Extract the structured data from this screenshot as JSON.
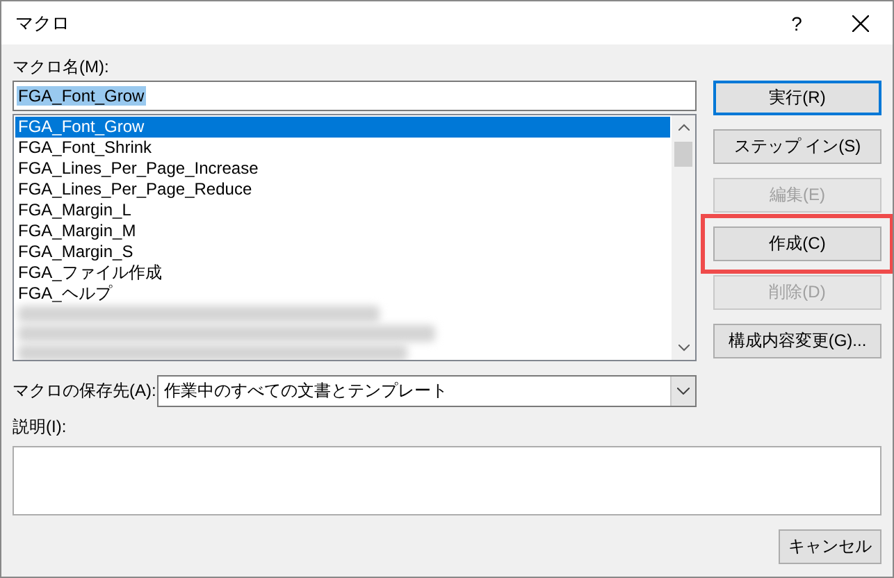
{
  "window": {
    "title": "マクロ",
    "help": "?"
  },
  "name_label": "マクロ名(M):",
  "name_field": {
    "value": "FGA_Font_Grow"
  },
  "macros": [
    {
      "kind": "text",
      "label": "FGA_Font_Grow",
      "selected": true
    },
    {
      "kind": "text",
      "label": "FGA_Font_Shrink",
      "selected": false
    },
    {
      "kind": "text",
      "label": "FGA_Lines_Per_Page_Increase",
      "selected": false
    },
    {
      "kind": "text",
      "label": "FGA_Lines_Per_Page_Reduce",
      "selected": false
    },
    {
      "kind": "text",
      "label": "FGA_Margin_L",
      "selected": false
    },
    {
      "kind": "text",
      "label": "FGA_Margin_M",
      "selected": false
    },
    {
      "kind": "text",
      "label": "FGA_Margin_S",
      "selected": false
    },
    {
      "kind": "text",
      "label": "FGA_ファイル作成",
      "selected": false
    },
    {
      "kind": "text",
      "label": "FGA_ヘルプ",
      "selected": false
    },
    {
      "kind": "blurred",
      "selected": false
    },
    {
      "kind": "blurred",
      "selected": false
    },
    {
      "kind": "blurred",
      "selected": false
    }
  ],
  "buttons": [
    {
      "label": "実行(R)",
      "disabled": false,
      "default": true,
      "highlighted": false
    },
    {
      "label": "ステップ イン(S)",
      "disabled": false,
      "default": false,
      "highlighted": false
    },
    {
      "label": "編集(E)",
      "disabled": true,
      "default": false,
      "highlighted": false
    },
    {
      "label": "作成(C)",
      "disabled": false,
      "default": false,
      "highlighted": true
    },
    {
      "label": "削除(D)",
      "disabled": true,
      "default": false,
      "highlighted": false
    },
    {
      "label": "構成内容変更(G)...",
      "disabled": false,
      "default": false,
      "highlighted": false
    }
  ],
  "location": {
    "label": "マクロの保存先(A):",
    "value": "作業中のすべての文書とテンプレート"
  },
  "description": {
    "label": "説明(I):"
  },
  "cancel": "キャンセル"
}
